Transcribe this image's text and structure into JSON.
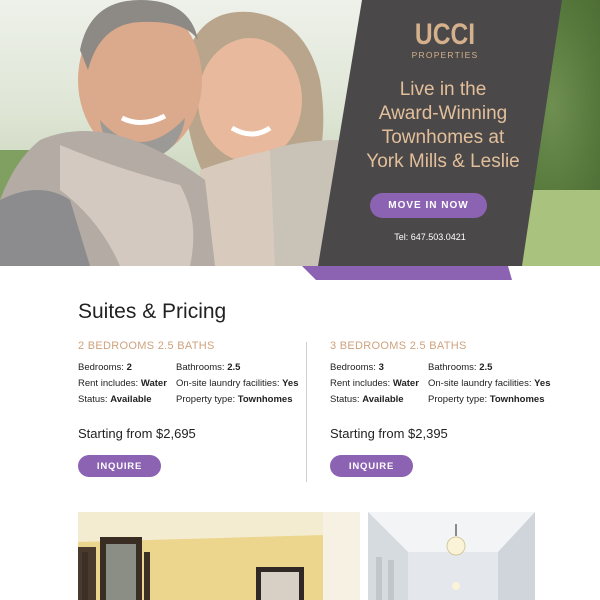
{
  "hero": {
    "brand_name": "UCCI",
    "brand_sub": "PROPERTIES",
    "headline_lines": [
      "Live in the",
      "Award-Winning",
      "Townhomes at",
      "York Mills & Leslie"
    ],
    "cta_label": "MOVE IN NOW",
    "phone": "Tel: 647.503.0421"
  },
  "suites": {
    "title": "Suites & Pricing",
    "items": [
      {
        "name": "2 BEDROOMS 2.5 BATHS",
        "bedrooms_label": "Bedrooms:",
        "bedrooms": "2",
        "bathrooms_label": "Bathrooms:",
        "bathrooms": "2.5",
        "rent_label": "Rent includes:",
        "rent": "Water",
        "laundry_label": "On-site laundry facilities:",
        "laundry": "Yes",
        "status_label": "Status:",
        "status": "Available",
        "type_label": "Property type:",
        "type": "Townhomes",
        "price": "Starting from $2,695",
        "button": "INQUIRE"
      },
      {
        "name": "3 BEDROOMS 2.5 BATHS",
        "bedrooms_label": "Bedrooms:",
        "bedrooms": "3",
        "bathrooms_label": "Bathrooms:",
        "bathrooms": "2.5",
        "rent_label": "Rent includes:",
        "rent": "Water",
        "laundry_label": "On-site laundry facilities:",
        "laundry": "Yes",
        "status_label": "Status:",
        "status": "Available",
        "type_label": "Property type:",
        "type": "Townhomes",
        "price": "Starting from $2,395",
        "button": "INQUIRE"
      }
    ]
  },
  "colors": {
    "accent_purple": "#8c63b3",
    "panel_gray": "#4a4849",
    "gold_text": "#d4b08c",
    "suite_title": "#cfa27d"
  }
}
